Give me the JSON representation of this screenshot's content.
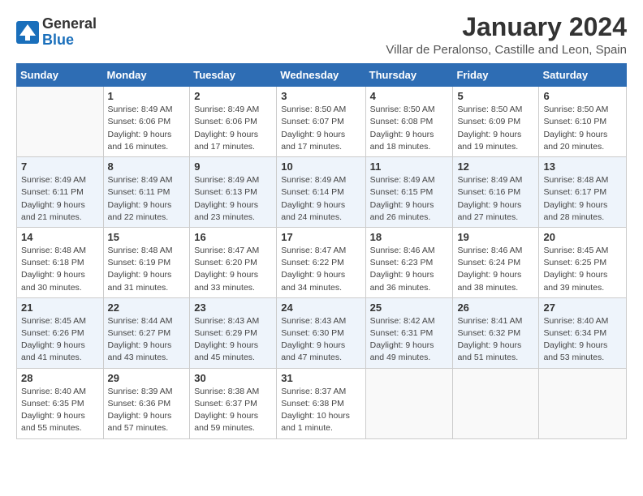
{
  "logo": {
    "general": "General",
    "blue": "Blue"
  },
  "title": "January 2024",
  "location": "Villar de Peralonso, Castille and Leon, Spain",
  "weekdays": [
    "Sunday",
    "Monday",
    "Tuesday",
    "Wednesday",
    "Thursday",
    "Friday",
    "Saturday"
  ],
  "weeks": [
    [
      {
        "day": "",
        "info": ""
      },
      {
        "day": "1",
        "info": "Sunrise: 8:49 AM\nSunset: 6:06 PM\nDaylight: 9 hours\nand 16 minutes."
      },
      {
        "day": "2",
        "info": "Sunrise: 8:49 AM\nSunset: 6:06 PM\nDaylight: 9 hours\nand 17 minutes."
      },
      {
        "day": "3",
        "info": "Sunrise: 8:50 AM\nSunset: 6:07 PM\nDaylight: 9 hours\nand 17 minutes."
      },
      {
        "day": "4",
        "info": "Sunrise: 8:50 AM\nSunset: 6:08 PM\nDaylight: 9 hours\nand 18 minutes."
      },
      {
        "day": "5",
        "info": "Sunrise: 8:50 AM\nSunset: 6:09 PM\nDaylight: 9 hours\nand 19 minutes."
      },
      {
        "day": "6",
        "info": "Sunrise: 8:50 AM\nSunset: 6:10 PM\nDaylight: 9 hours\nand 20 minutes."
      }
    ],
    [
      {
        "day": "7",
        "info": ""
      },
      {
        "day": "8",
        "info": "Sunrise: 8:49 AM\nSunset: 6:11 PM\nDaylight: 9 hours\nand 22 minutes."
      },
      {
        "day": "9",
        "info": "Sunrise: 8:49 AM\nSunset: 6:13 PM\nDaylight: 9 hours\nand 23 minutes."
      },
      {
        "day": "10",
        "info": "Sunrise: 8:49 AM\nSunset: 6:14 PM\nDaylight: 9 hours\nand 24 minutes."
      },
      {
        "day": "11",
        "info": "Sunrise: 8:49 AM\nSunset: 6:15 PM\nDaylight: 9 hours\nand 26 minutes."
      },
      {
        "day": "12",
        "info": "Sunrise: 8:49 AM\nSunset: 6:16 PM\nDaylight: 9 hours\nand 27 minutes."
      },
      {
        "day": "13",
        "info": "Sunrise: 8:48 AM\nSunset: 6:17 PM\nDaylight: 9 hours\nand 28 minutes."
      }
    ],
    [
      {
        "day": "14",
        "info": ""
      },
      {
        "day": "15",
        "info": "Sunrise: 8:48 AM\nSunset: 6:19 PM\nDaylight: 9 hours\nand 31 minutes."
      },
      {
        "day": "16",
        "info": "Sunrise: 8:47 AM\nSunset: 6:20 PM\nDaylight: 9 hours\nand 33 minutes."
      },
      {
        "day": "17",
        "info": "Sunrise: 8:47 AM\nSunset: 6:22 PM\nDaylight: 9 hours\nand 34 minutes."
      },
      {
        "day": "18",
        "info": "Sunrise: 8:46 AM\nSunset: 6:23 PM\nDaylight: 9 hours\nand 36 minutes."
      },
      {
        "day": "19",
        "info": "Sunrise: 8:46 AM\nSunset: 6:24 PM\nDaylight: 9 hours\nand 38 minutes."
      },
      {
        "day": "20",
        "info": "Sunrise: 8:45 AM\nSunset: 6:25 PM\nDaylight: 9 hours\nand 39 minutes."
      }
    ],
    [
      {
        "day": "21",
        "info": ""
      },
      {
        "day": "22",
        "info": "Sunrise: 8:44 AM\nSunset: 6:27 PM\nDaylight: 9 hours\nand 43 minutes."
      },
      {
        "day": "23",
        "info": "Sunrise: 8:43 AM\nSunset: 6:29 PM\nDaylight: 9 hours\nand 45 minutes."
      },
      {
        "day": "24",
        "info": "Sunrise: 8:43 AM\nSunset: 6:30 PM\nDaylight: 9 hours\nand 47 minutes."
      },
      {
        "day": "25",
        "info": "Sunrise: 8:42 AM\nSunset: 6:31 PM\nDaylight: 9 hours\nand 49 minutes."
      },
      {
        "day": "26",
        "info": "Sunrise: 8:41 AM\nSunset: 6:32 PM\nDaylight: 9 hours\nand 51 minutes."
      },
      {
        "day": "27",
        "info": "Sunrise: 8:40 AM\nSunset: 6:34 PM\nDaylight: 9 hours\nand 53 minutes."
      }
    ],
    [
      {
        "day": "28",
        "info": ""
      },
      {
        "day": "29",
        "info": "Sunrise: 8:39 AM\nSunset: 6:36 PM\nDaylight: 9 hours\nand 57 minutes."
      },
      {
        "day": "30",
        "info": "Sunrise: 8:38 AM\nSunset: 6:37 PM\nDaylight: 9 hours\nand 59 minutes."
      },
      {
        "day": "31",
        "info": "Sunrise: 8:37 AM\nSunset: 6:38 PM\nDaylight: 10 hours\nand 1 minute."
      },
      {
        "day": "",
        "info": ""
      },
      {
        "day": "",
        "info": ""
      },
      {
        "day": "",
        "info": ""
      }
    ]
  ],
  "week0_sunday_info": "Sunrise: 8:49 AM\nSunset: 6:11 PM\nDaylight: 9 hours\nand 21 minutes.",
  "week2_sunday_info": "Sunrise: 8:48 AM\nSunset: 6:18 PM\nDaylight: 9 hours\nand 30 minutes.",
  "week3_sunday_info": "Sunrise: 8:45 AM\nSunset: 6:26 PM\nDaylight: 9 hours\nand 41 minutes.",
  "week4_sunday_info": "Sunrise: 8:40 AM\nSunset: 6:35 PM\nDaylight: 9 hours\nand 55 minutes."
}
